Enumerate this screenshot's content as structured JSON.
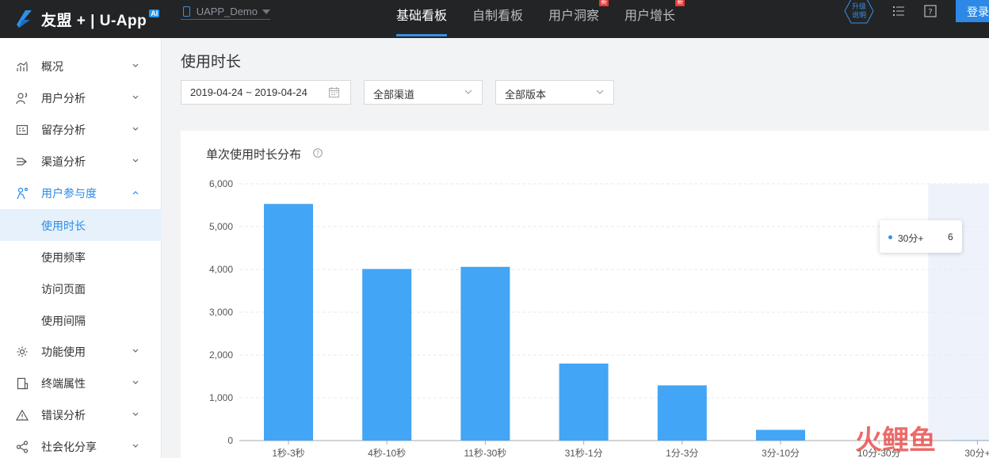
{
  "topbar": {
    "brand": "友盟 + | U-App",
    "brand_badge": "AI",
    "app_name": "UAPP_Demo",
    "nav": [
      {
        "label": "基础看板",
        "active": true,
        "badge": ""
      },
      {
        "label": "自制看板",
        "active": false,
        "badge": ""
      },
      {
        "label": "用户洞察",
        "active": false,
        "badge": "新"
      },
      {
        "label": "用户增长",
        "active": false,
        "badge": "新"
      }
    ],
    "upgrade_line1": "升级",
    "upgrade_line2": "说明",
    "login_label": "登录"
  },
  "sidebar": {
    "items": [
      {
        "label": "概况",
        "icon": "bar-trend-icon"
      },
      {
        "label": "用户分析",
        "icon": "user-question-icon"
      },
      {
        "label": "留存分析",
        "icon": "retention-grid-icon"
      },
      {
        "label": "渠道分析",
        "icon": "channel-arrows-icon"
      },
      {
        "label": "用户参与度",
        "icon": "engagement-icon",
        "open": true
      },
      {
        "label": "功能使用",
        "icon": "gear-icon"
      },
      {
        "label": "终端属性",
        "icon": "device-icon"
      },
      {
        "label": "错误分析",
        "icon": "warning-icon"
      },
      {
        "label": "社会化分享",
        "icon": "share-icon"
      }
    ],
    "sub_items": [
      "使用时长",
      "使用频率",
      "访问页面",
      "使用间隔"
    ],
    "active_sub": "使用时长"
  },
  "page": {
    "title": "使用时长",
    "date_range": "2019-04-24 ~ 2019-04-24",
    "channel": "全部渠道",
    "version": "全部版本"
  },
  "card": {
    "title": "单次使用时长分布"
  },
  "colors": {
    "bar": "#42a5f5",
    "accent": "#2c8ae6",
    "topbar": "#222426"
  },
  "chart_data": {
    "type": "bar",
    "categories": [
      "1秒-3秒",
      "4秒-10秒",
      "11秒-30秒",
      "31秒-1分",
      "1分-3分",
      "3分-10分",
      "10分-30分",
      "30分+"
    ],
    "values": [
      5530,
      4010,
      4060,
      1800,
      1290,
      250,
      0,
      6
    ],
    "ylim": [
      0,
      6000
    ],
    "yticks": [
      "6,000",
      "5,000",
      "4,000",
      "3,000",
      "2,000",
      "1,000",
      "0"
    ],
    "grid": true,
    "highlighted_category": "30分+",
    "tooltip": {
      "name": "30分+",
      "value": "6"
    }
  },
  "watermark": "火鲤鱼"
}
